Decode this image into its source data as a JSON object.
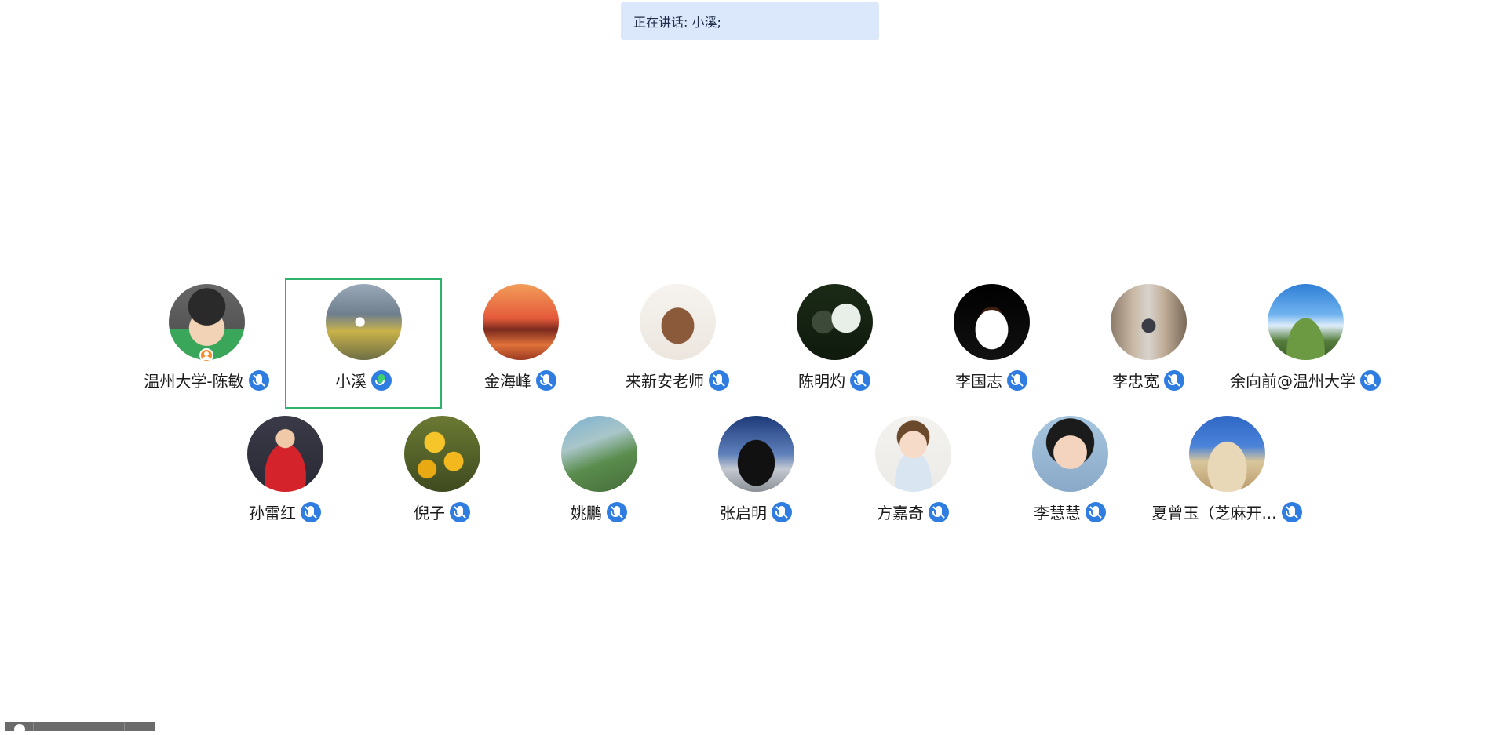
{
  "banner": {
    "text": "正在讲话: 小溪;"
  },
  "participants": [
    {
      "name": "温州大学-陈敏",
      "avatar": "cartoon-man-glasses-icon",
      "host": true,
      "speaking": false
    },
    {
      "name": "小溪",
      "avatar": "lakeside-person-photo",
      "host": false,
      "speaking": true
    },
    {
      "name": "金海峰",
      "avatar": "sunset-pier-photo",
      "host": false,
      "speaking": false
    },
    {
      "name": "来新安老师",
      "avatar": "ox-drawing-photo",
      "host": false,
      "speaking": false
    },
    {
      "name": "陈明灼",
      "avatar": "person-with-sign-photo",
      "host": false,
      "speaking": false
    },
    {
      "name": "李国志",
      "avatar": "coffee-cup-photo",
      "host": false,
      "speaking": false
    },
    {
      "name": "李忠宽",
      "avatar": "street-person-photo",
      "host": false,
      "speaking": false
    },
    {
      "name": "余向前@温州大学",
      "avatar": "mountain-sky-photo",
      "host": false,
      "speaking": false
    },
    {
      "name": "孙雷红",
      "avatar": "woman-red-dress-photo",
      "host": false,
      "speaking": false
    },
    {
      "name": "倪子",
      "avatar": "yellow-flowers-photo",
      "host": false,
      "speaking": false
    },
    {
      "name": "姚鹏",
      "avatar": "aerial-landscape-photo",
      "host": false,
      "speaking": false
    },
    {
      "name": "张启明",
      "avatar": "black-truck-photo",
      "host": false,
      "speaking": false
    },
    {
      "name": "方嘉奇",
      "avatar": "cartoon-boy-tie-icon",
      "host": false,
      "speaking": false
    },
    {
      "name": "李慧慧",
      "avatar": "cartoon-girl-icecream-icon",
      "host": false,
      "speaking": false
    },
    {
      "name": "夏曾玉（芝麻开...",
      "avatar": "palace-building-photo",
      "host": false,
      "speaking": false
    }
  ],
  "colors": {
    "active_border": "#2fb36c",
    "mic_blue": "#2f7de1",
    "banner_bg": "#dbe8fb",
    "host_badge": "#f58b2a"
  }
}
